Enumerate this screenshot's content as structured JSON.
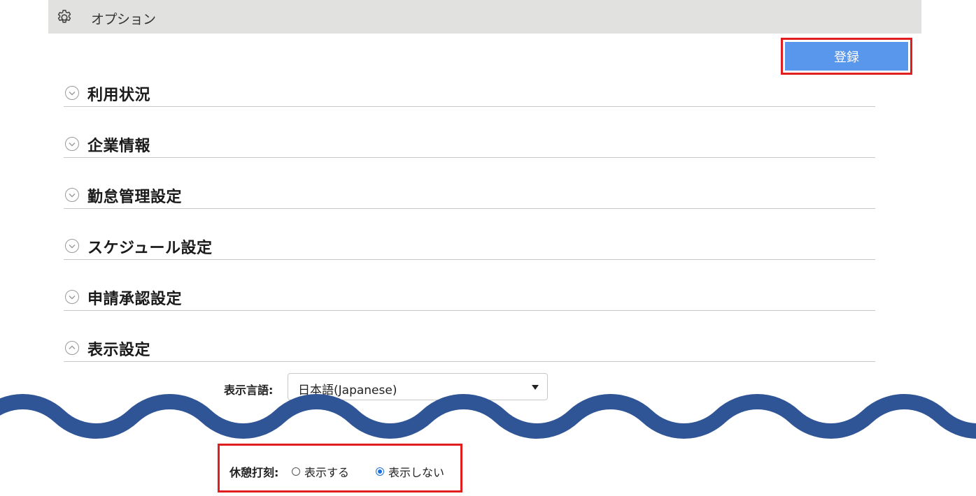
{
  "header": {
    "title": "オプション",
    "icon": "gear-icon"
  },
  "toolbar": {
    "register_label": "登録"
  },
  "sections": [
    {
      "label": "利用状況",
      "state": "collapsed"
    },
    {
      "label": "企業情報",
      "state": "collapsed"
    },
    {
      "label": "勤怠管理設定",
      "state": "collapsed"
    },
    {
      "label": "スケジュール設定",
      "state": "collapsed"
    },
    {
      "label": "申請承認設定",
      "state": "collapsed"
    },
    {
      "label": "表示設定",
      "state": "expanded"
    }
  ],
  "display_settings": {
    "language_label": "表示言語:",
    "language_value": "日本語(Japanese)",
    "break_label": "休憩打刻:",
    "break_options": [
      {
        "label": "表示する",
        "selected": false
      },
      {
        "label": "表示しない",
        "selected": true
      }
    ]
  },
  "colors": {
    "accent": "#5897ec",
    "highlight": "#e11e1e",
    "wave": "#2f5596",
    "header_bg": "#e1e1e0"
  }
}
